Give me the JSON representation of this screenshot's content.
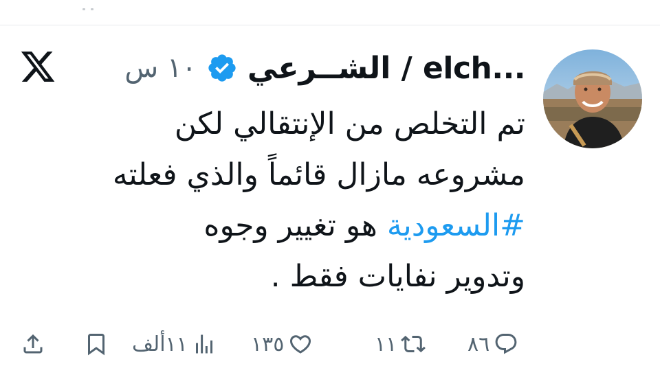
{
  "tweet": {
    "display_name": "الشــرعي / elch...",
    "timestamp": "١٠ س",
    "text_lines": [
      "تم التخلص من الإنتقالي لكن",
      "مشروعه مازال قائماً والذي فعلته",
      "هو تغيير وجوه",
      "وتدوير نفايات فقط ."
    ],
    "hashtag": "#السعودية"
  },
  "actions": {
    "replies": "٨٦",
    "retweets": "١١",
    "likes": "١٣٥",
    "views": "١١ألف"
  },
  "colors": {
    "accent": "#1d9bf0",
    "text": "#0f1419",
    "muted": "#536471"
  },
  "icons": {
    "verified": "verified-badge-icon",
    "logo": "x-logo-icon",
    "reply": "reply-icon",
    "retweet": "retweet-icon",
    "like": "heart-icon",
    "views": "views-icon",
    "bookmark": "bookmark-icon",
    "share": "share-icon"
  }
}
